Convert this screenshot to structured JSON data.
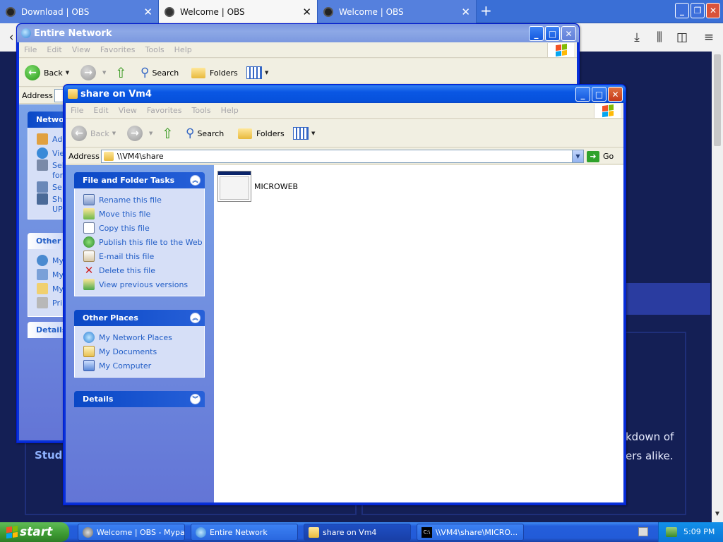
{
  "browser": {
    "tabs": [
      {
        "label": "Download | OBS",
        "active": false
      },
      {
        "label": "Welcome | OBS",
        "active": true
      },
      {
        "label": "Welcome | OBS",
        "active": false
      }
    ],
    "new_tab": "+",
    "page_text_left": "Studi",
    "page_text_right_1": "kdown of",
    "page_text_right_2": "ers alike."
  },
  "back_window": {
    "title": "Entire Network",
    "menu": [
      "File",
      "Edit",
      "View",
      "Favorites",
      "Tools",
      "Help"
    ],
    "toolbar": {
      "back": "Back",
      "search": "Search",
      "folders": "Folders"
    },
    "address_label": "Address",
    "side_panels": {
      "network_header": "Networ",
      "network_items": [
        "Ad",
        "Vie",
        "Sel",
        "for",
        "Se",
        "Sh",
        "UP"
      ],
      "other_header": "Other",
      "other_items": [
        "My",
        "My",
        "My",
        "Pri"
      ],
      "details_header": "Details"
    }
  },
  "front_window": {
    "title": "share on Vm4",
    "menu": [
      "File",
      "Edit",
      "View",
      "Favorites",
      "Tools",
      "Help"
    ],
    "toolbar": {
      "back": "Back",
      "search": "Search",
      "folders": "Folders"
    },
    "address_label": "Address",
    "address_value": "\\\\VM4\\share",
    "go_label": "Go",
    "file_tasks": {
      "header": "File and Folder Tasks",
      "items": [
        {
          "label": "Rename this file",
          "icon": "rename-icon"
        },
        {
          "label": "Move this file",
          "icon": "move-icon"
        },
        {
          "label": "Copy this file",
          "icon": "copy-icon"
        },
        {
          "label": "Publish this file to the Web",
          "icon": "publish-icon"
        },
        {
          "label": "E-mail this file",
          "icon": "email-icon"
        },
        {
          "label": "Delete this file",
          "icon": "delete-icon"
        },
        {
          "label": "View previous versions",
          "icon": "versions-icon"
        }
      ]
    },
    "other_places": {
      "header": "Other Places",
      "items": [
        {
          "label": "My Network Places",
          "icon": "network-places-icon"
        },
        {
          "label": "My Documents",
          "icon": "documents-icon"
        },
        {
          "label": "My Computer",
          "icon": "computer-icon"
        }
      ]
    },
    "details_header": "Details",
    "files": [
      {
        "name": "MICROWEB",
        "icon": "application-icon"
      }
    ]
  },
  "taskbar": {
    "start": "start",
    "buttons": [
      {
        "label": "Welcome | OBS - Mypal",
        "active": false
      },
      {
        "label": "Entire Network",
        "active": false
      },
      {
        "label": "share on Vm4",
        "active": true
      },
      {
        "label": "\\\\VM4\\share\\MICRO...",
        "active": false
      }
    ],
    "clock": "5:09 PM"
  },
  "colors": {
    "xp_blue": "#0a57e4",
    "task_pane": "#6375d6",
    "link": "#215dc6",
    "start_green": "#3c9a32"
  }
}
